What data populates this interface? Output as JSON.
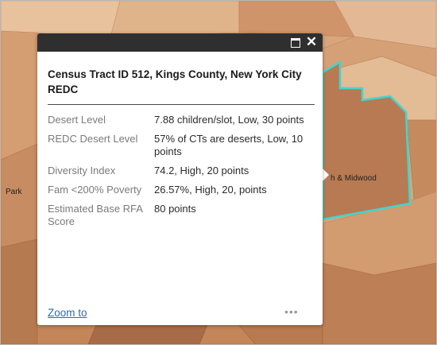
{
  "map": {
    "labels": {
      "neighborhood_right": "h & Midwood",
      "neighborhood_left": "Park"
    },
    "colors": {
      "light": "#e6bf99",
      "medium": "#d9a57c",
      "dark": "#b77a52",
      "darker": "#a06642",
      "highlight_outline": "#3fd6cf"
    }
  },
  "popup": {
    "title": "Census Tract ID 512, Kings County, New York City REDC",
    "fields": [
      {
        "label": "Desert Level",
        "value": "7.88 children/slot, Low, 30 points"
      },
      {
        "label": "REDC Desert Level",
        "value": "57% of CTs are deserts, Low, 10 points"
      },
      {
        "label": "Diversity Index",
        "value": "74.2, High, 20 points"
      },
      {
        "label": "Fam <200% Poverty",
        "value": "26.57%, High, 20, points"
      },
      {
        "label": "Estimated Base RFA Score",
        "value": "80 points"
      }
    ],
    "zoom_label": "Zoom to",
    "more_label": "•••",
    "close_glyph": "✕"
  }
}
